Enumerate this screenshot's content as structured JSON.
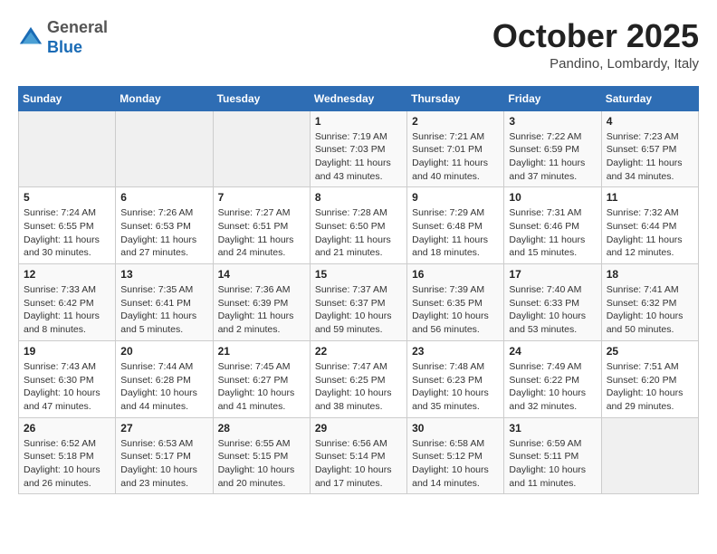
{
  "header": {
    "logo": {
      "general": "General",
      "blue": "Blue"
    },
    "title": "October 2025",
    "subtitle": "Pandino, Lombardy, Italy"
  },
  "calendar": {
    "days_of_week": [
      "Sunday",
      "Monday",
      "Tuesday",
      "Wednesday",
      "Thursday",
      "Friday",
      "Saturday"
    ],
    "weeks": [
      [
        {
          "day": "",
          "info": ""
        },
        {
          "day": "",
          "info": ""
        },
        {
          "day": "",
          "info": ""
        },
        {
          "day": "1",
          "info": "Sunrise: 7:19 AM\nSunset: 7:03 PM\nDaylight: 11 hours\nand 43 minutes."
        },
        {
          "day": "2",
          "info": "Sunrise: 7:21 AM\nSunset: 7:01 PM\nDaylight: 11 hours\nand 40 minutes."
        },
        {
          "day": "3",
          "info": "Sunrise: 7:22 AM\nSunset: 6:59 PM\nDaylight: 11 hours\nand 37 minutes."
        },
        {
          "day": "4",
          "info": "Sunrise: 7:23 AM\nSunset: 6:57 PM\nDaylight: 11 hours\nand 34 minutes."
        }
      ],
      [
        {
          "day": "5",
          "info": "Sunrise: 7:24 AM\nSunset: 6:55 PM\nDaylight: 11 hours\nand 30 minutes."
        },
        {
          "day": "6",
          "info": "Sunrise: 7:26 AM\nSunset: 6:53 PM\nDaylight: 11 hours\nand 27 minutes."
        },
        {
          "day": "7",
          "info": "Sunrise: 7:27 AM\nSunset: 6:51 PM\nDaylight: 11 hours\nand 24 minutes."
        },
        {
          "day": "8",
          "info": "Sunrise: 7:28 AM\nSunset: 6:50 PM\nDaylight: 11 hours\nand 21 minutes."
        },
        {
          "day": "9",
          "info": "Sunrise: 7:29 AM\nSunset: 6:48 PM\nDaylight: 11 hours\nand 18 minutes."
        },
        {
          "day": "10",
          "info": "Sunrise: 7:31 AM\nSunset: 6:46 PM\nDaylight: 11 hours\nand 15 minutes."
        },
        {
          "day": "11",
          "info": "Sunrise: 7:32 AM\nSunset: 6:44 PM\nDaylight: 11 hours\nand 12 minutes."
        }
      ],
      [
        {
          "day": "12",
          "info": "Sunrise: 7:33 AM\nSunset: 6:42 PM\nDaylight: 11 hours\nand 8 minutes."
        },
        {
          "day": "13",
          "info": "Sunrise: 7:35 AM\nSunset: 6:41 PM\nDaylight: 11 hours\nand 5 minutes."
        },
        {
          "day": "14",
          "info": "Sunrise: 7:36 AM\nSunset: 6:39 PM\nDaylight: 11 hours\nand 2 minutes."
        },
        {
          "day": "15",
          "info": "Sunrise: 7:37 AM\nSunset: 6:37 PM\nDaylight: 10 hours\nand 59 minutes."
        },
        {
          "day": "16",
          "info": "Sunrise: 7:39 AM\nSunset: 6:35 PM\nDaylight: 10 hours\nand 56 minutes."
        },
        {
          "day": "17",
          "info": "Sunrise: 7:40 AM\nSunset: 6:33 PM\nDaylight: 10 hours\nand 53 minutes."
        },
        {
          "day": "18",
          "info": "Sunrise: 7:41 AM\nSunset: 6:32 PM\nDaylight: 10 hours\nand 50 minutes."
        }
      ],
      [
        {
          "day": "19",
          "info": "Sunrise: 7:43 AM\nSunset: 6:30 PM\nDaylight: 10 hours\nand 47 minutes."
        },
        {
          "day": "20",
          "info": "Sunrise: 7:44 AM\nSunset: 6:28 PM\nDaylight: 10 hours\nand 44 minutes."
        },
        {
          "day": "21",
          "info": "Sunrise: 7:45 AM\nSunset: 6:27 PM\nDaylight: 10 hours\nand 41 minutes."
        },
        {
          "day": "22",
          "info": "Sunrise: 7:47 AM\nSunset: 6:25 PM\nDaylight: 10 hours\nand 38 minutes."
        },
        {
          "day": "23",
          "info": "Sunrise: 7:48 AM\nSunset: 6:23 PM\nDaylight: 10 hours\nand 35 minutes."
        },
        {
          "day": "24",
          "info": "Sunrise: 7:49 AM\nSunset: 6:22 PM\nDaylight: 10 hours\nand 32 minutes."
        },
        {
          "day": "25",
          "info": "Sunrise: 7:51 AM\nSunset: 6:20 PM\nDaylight: 10 hours\nand 29 minutes."
        }
      ],
      [
        {
          "day": "26",
          "info": "Sunrise: 6:52 AM\nSunset: 5:18 PM\nDaylight: 10 hours\nand 26 minutes."
        },
        {
          "day": "27",
          "info": "Sunrise: 6:53 AM\nSunset: 5:17 PM\nDaylight: 10 hours\nand 23 minutes."
        },
        {
          "day": "28",
          "info": "Sunrise: 6:55 AM\nSunset: 5:15 PM\nDaylight: 10 hours\nand 20 minutes."
        },
        {
          "day": "29",
          "info": "Sunrise: 6:56 AM\nSunset: 5:14 PM\nDaylight: 10 hours\nand 17 minutes."
        },
        {
          "day": "30",
          "info": "Sunrise: 6:58 AM\nSunset: 5:12 PM\nDaylight: 10 hours\nand 14 minutes."
        },
        {
          "day": "31",
          "info": "Sunrise: 6:59 AM\nSunset: 5:11 PM\nDaylight: 10 hours\nand 11 minutes."
        },
        {
          "day": "",
          "info": ""
        }
      ]
    ]
  }
}
